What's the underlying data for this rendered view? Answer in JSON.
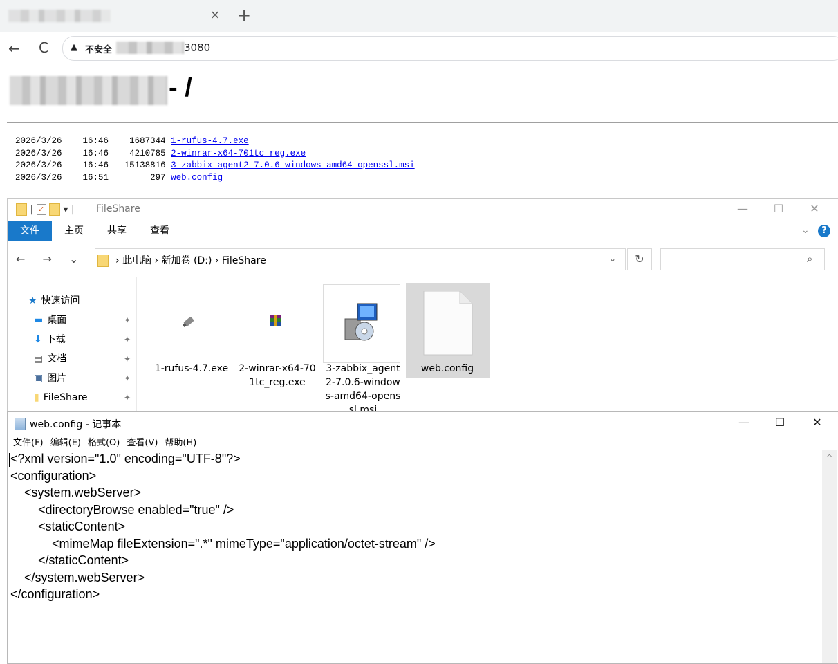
{
  "browser": {
    "tab_close": "×",
    "new_tab": "+",
    "back_icon": "←",
    "reload_icon": "C",
    "warning_icon": "▲",
    "insecure_label": "不安全",
    "url_suffix": "3080"
  },
  "page": {
    "heading_suffix": "- /",
    "listing": [
      {
        "date": "2026/3/26",
        "time": "16:46",
        "size": "1687344",
        "name": "1-rufus-4.7.exe"
      },
      {
        "date": "2026/3/26",
        "time": "16:46",
        "size": "4210785",
        "name": "2-winrar-x64-701tc_reg.exe"
      },
      {
        "date": "2026/3/26",
        "time": "16:46",
        "size": "15138816",
        "name": "3-zabbix_agent2-7.0.6-windows-amd64-openssl.msi"
      },
      {
        "date": "2026/3/26",
        "time": "16:51",
        "size": "297",
        "name": "web.config"
      }
    ]
  },
  "explorer": {
    "title": "FileShare",
    "qat_separator": "|",
    "qat_dropdown": "▾",
    "minimize": "—",
    "maximize": "☐",
    "close": "✕",
    "ribbon_tabs": [
      "文件",
      "主页",
      "共享",
      "查看"
    ],
    "help_icon": "?",
    "ribbon_expand": "⌄",
    "nav_arrows": "← → ⌄ ↑",
    "breadcrumb": "›  此电脑  ›  新加卷 (D:)  ›  FileShare",
    "address_dropdown": "⌄",
    "refresh_icon": "↻",
    "search_icon": "⌕",
    "nav_pane": [
      {
        "label": "快速访问",
        "icon": "★",
        "icon_color": "#1979ca",
        "pinned": false
      },
      {
        "label": "桌面",
        "icon": "▬",
        "icon_color": "#1e88e5",
        "pinned": true
      },
      {
        "label": "下载",
        "icon": "⬇",
        "icon_color": "#1e88e5",
        "pinned": true
      },
      {
        "label": "文档",
        "icon": "▤",
        "icon_color": "#666666",
        "pinned": true
      },
      {
        "label": "图片",
        "icon": "▣",
        "icon_color": "#4a6f9c",
        "pinned": true
      },
      {
        "label": "FileShare",
        "icon": "▮",
        "icon_color": "#f8d775",
        "pinned": true
      }
    ],
    "pin_icon": "✦",
    "files": [
      {
        "name_lines": [
          "1-rufus-4.7.exe"
        ],
        "icon": "usb-drive-icon"
      },
      {
        "name_lines": [
          "2-winrar-x64-70",
          "1tc_reg.exe"
        ],
        "icon": "winrar-icon"
      },
      {
        "name_lines": [
          "3-zabbix_agent",
          "2-7.0.6-window",
          "s-amd64-opens",
          "sl.msi"
        ],
        "icon": "installer-icon"
      },
      {
        "name_lines": [
          "web.config"
        ],
        "icon": "document-icon"
      }
    ]
  },
  "notepad": {
    "title": "web.config - 记事本",
    "minimize": "—",
    "maximize": "☐",
    "close": "✕",
    "menus": [
      "文件(F)",
      "编辑(E)",
      "格式(O)",
      "查看(V)",
      "帮助(H)"
    ],
    "scroll_up": "^",
    "lines": [
      "<?xml version=\"1.0\" encoding=\"UTF-8\"?>",
      "<configuration>",
      "    <system.webServer>",
      "        <directoryBrowse enabled=\"true\" />",
      "        <staticContent>",
      "            <mimeMap fileExtension=\".*\" mimeType=\"application/octet-stream\" />",
      "        </staticContent>",
      "    </system.webServer>",
      "</configuration>"
    ]
  }
}
